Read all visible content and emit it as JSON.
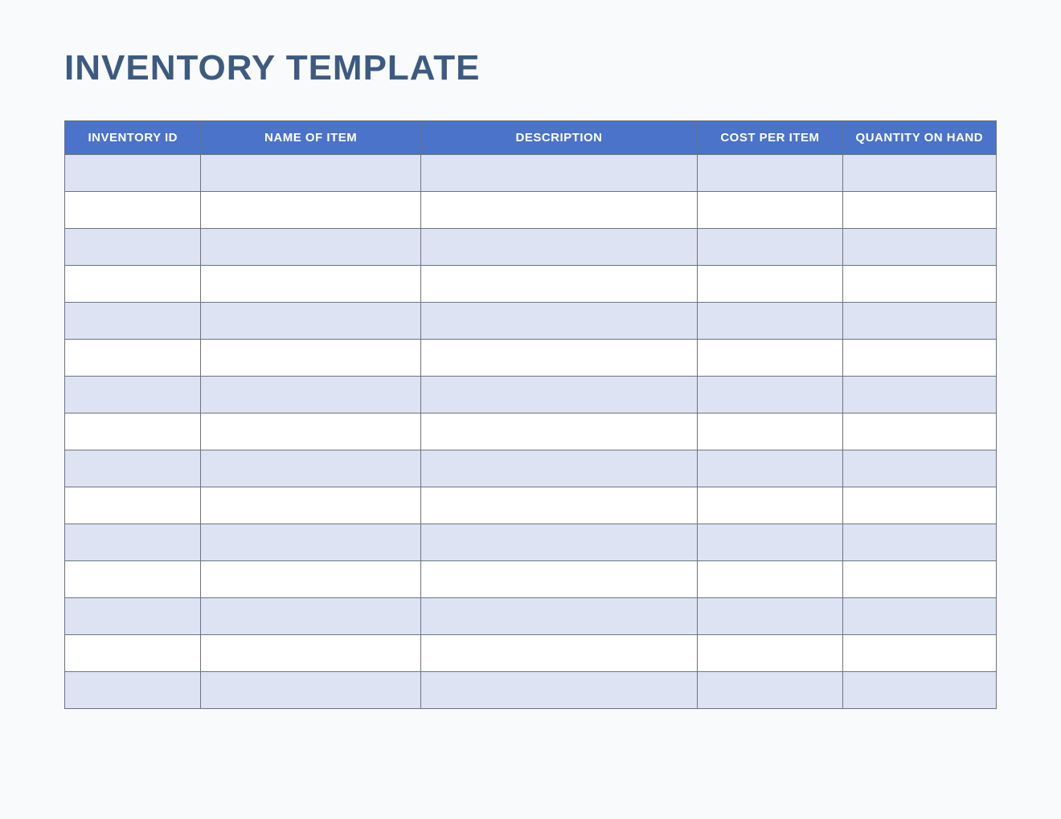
{
  "title": "INVENTORY TEMPLATE",
  "columns": [
    "INVENTORY ID",
    "NAME OF ITEM",
    "DESCRIPTION",
    "COST PER ITEM",
    "QUANTITY ON HAND"
  ],
  "rows": [
    {
      "inventory_id": "",
      "name": "",
      "description": "",
      "cost": "",
      "quantity": ""
    },
    {
      "inventory_id": "",
      "name": "",
      "description": "",
      "cost": "",
      "quantity": ""
    },
    {
      "inventory_id": "",
      "name": "",
      "description": "",
      "cost": "",
      "quantity": ""
    },
    {
      "inventory_id": "",
      "name": "",
      "description": "",
      "cost": "",
      "quantity": ""
    },
    {
      "inventory_id": "",
      "name": "",
      "description": "",
      "cost": "",
      "quantity": ""
    },
    {
      "inventory_id": "",
      "name": "",
      "description": "",
      "cost": "",
      "quantity": ""
    },
    {
      "inventory_id": "",
      "name": "",
      "description": "",
      "cost": "",
      "quantity": ""
    },
    {
      "inventory_id": "",
      "name": "",
      "description": "",
      "cost": "",
      "quantity": ""
    },
    {
      "inventory_id": "",
      "name": "",
      "description": "",
      "cost": "",
      "quantity": ""
    },
    {
      "inventory_id": "",
      "name": "",
      "description": "",
      "cost": "",
      "quantity": ""
    },
    {
      "inventory_id": "",
      "name": "",
      "description": "",
      "cost": "",
      "quantity": ""
    },
    {
      "inventory_id": "",
      "name": "",
      "description": "",
      "cost": "",
      "quantity": ""
    },
    {
      "inventory_id": "",
      "name": "",
      "description": "",
      "cost": "",
      "quantity": ""
    },
    {
      "inventory_id": "",
      "name": "",
      "description": "",
      "cost": "",
      "quantity": ""
    },
    {
      "inventory_id": "",
      "name": "",
      "description": "",
      "cost": "",
      "quantity": ""
    }
  ],
  "colors": {
    "header_bg": "#4a73c9",
    "odd_row_bg": "#dde3f3",
    "even_row_bg": "#ffffff",
    "title_color": "#3d5a80",
    "border": "#6b7280"
  }
}
